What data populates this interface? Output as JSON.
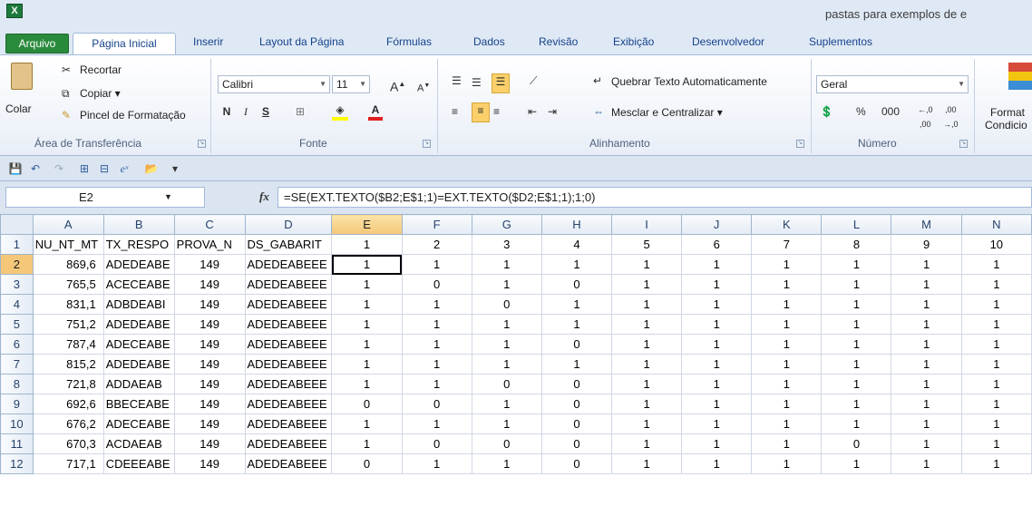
{
  "window": {
    "app_icon_letter": "X",
    "title": "pastas para exemplos de e"
  },
  "tabs": [
    "Arquivo",
    "Página Inicial",
    "Inserir",
    "Layout da Página",
    "Fórmulas",
    "Dados",
    "Revisão",
    "Exibição",
    "Desenvolvedor",
    "Suplementos"
  ],
  "ribbon": {
    "clipboard": {
      "paste": "Colar",
      "cut": "Recortar",
      "copy": "Copiar ▾",
      "format_painter": "Pincel de Formatação",
      "label": "Área de Transferência"
    },
    "font": {
      "name": "Calibri",
      "size": "11",
      "label": "Fonte",
      "bold": "N",
      "italic": "I",
      "underline": "S"
    },
    "alignment": {
      "wrap": "Quebrar Texto Automaticamente",
      "merge": "Mesclar e Centralizar ▾",
      "label": "Alinhamento"
    },
    "number": {
      "format": "Geral",
      "percent": "%",
      "thousands": "000",
      "label": "Número"
    },
    "styles": {
      "conditional": "Format",
      "conditional2": "Condicio"
    }
  },
  "formula_bar": {
    "name_box": "E2",
    "fx": "fx",
    "formula": "=SE(EXT.TEXTO($B2;E$1;1)=EXT.TEXTO($D2;E$1;1);1;0)"
  },
  "grid": {
    "columns": [
      "A",
      "B",
      "C",
      "D",
      "E",
      "F",
      "G",
      "H",
      "I",
      "J",
      "K",
      "L",
      "M",
      "N"
    ],
    "selected_column": "E",
    "selected_row": "2",
    "rows": [
      {
        "n": "1",
        "cells": [
          "NU_NT_MT",
          "TX_RESPO",
          "PROVA_N",
          "DS_GABARIT",
          "1",
          "2",
          "3",
          "4",
          "5",
          "6",
          "7",
          "8",
          "9",
          "10"
        ]
      },
      {
        "n": "2",
        "cells": [
          "869,6",
          "ADEDEABE",
          "149",
          "ADEDEABEEE",
          "1",
          "1",
          "1",
          "1",
          "1",
          "1",
          "1",
          "1",
          "1",
          "1"
        ]
      },
      {
        "n": "3",
        "cells": [
          "765,5",
          "ACECEABE",
          "149",
          "ADEDEABEEE",
          "1",
          "0",
          "1",
          "0",
          "1",
          "1",
          "1",
          "1",
          "1",
          "1"
        ]
      },
      {
        "n": "4",
        "cells": [
          "831,1",
          "ADBDEABI",
          "149",
          "ADEDEABEEE",
          "1",
          "1",
          "0",
          "1",
          "1",
          "1",
          "1",
          "1",
          "1",
          "1"
        ]
      },
      {
        "n": "5",
        "cells": [
          "751,2",
          "ADEDEABE",
          "149",
          "ADEDEABEEE",
          "1",
          "1",
          "1",
          "1",
          "1",
          "1",
          "1",
          "1",
          "1",
          "1"
        ]
      },
      {
        "n": "6",
        "cells": [
          "787,4",
          "ADECEABE",
          "149",
          "ADEDEABEEE",
          "1",
          "1",
          "1",
          "0",
          "1",
          "1",
          "1",
          "1",
          "1",
          "1"
        ]
      },
      {
        "n": "7",
        "cells": [
          "815,2",
          "ADEDEABE",
          "149",
          "ADEDEABEEE",
          "1",
          "1",
          "1",
          "1",
          "1",
          "1",
          "1",
          "1",
          "1",
          "1"
        ]
      },
      {
        "n": "8",
        "cells": [
          "721,8",
          "ADDAEAB",
          "149",
          "ADEDEABEEE",
          "1",
          "1",
          "0",
          "0",
          "1",
          "1",
          "1",
          "1",
          "1",
          "1"
        ]
      },
      {
        "n": "9",
        "cells": [
          "692,6",
          "BBECEABE",
          "149",
          "ADEDEABEEE",
          "0",
          "0",
          "1",
          "0",
          "1",
          "1",
          "1",
          "1",
          "1",
          "1"
        ]
      },
      {
        "n": "10",
        "cells": [
          "676,2",
          "ADECEABE",
          "149",
          "ADEDEABEEE",
          "1",
          "1",
          "1",
          "0",
          "1",
          "1",
          "1",
          "1",
          "1",
          "1"
        ]
      },
      {
        "n": "11",
        "cells": [
          "670,3",
          "ACDAEAB",
          "149",
          "ADEDEABEEE",
          "1",
          "0",
          "0",
          "0",
          "1",
          "1",
          "1",
          "0",
          "1",
          "1"
        ]
      },
      {
        "n": "12",
        "cells": [
          "717,1",
          "CDEEEABE",
          "149",
          "ADEDEABEEE",
          "0",
          "1",
          "1",
          "0",
          "1",
          "1",
          "1",
          "1",
          "1",
          "1"
        ]
      }
    ]
  }
}
